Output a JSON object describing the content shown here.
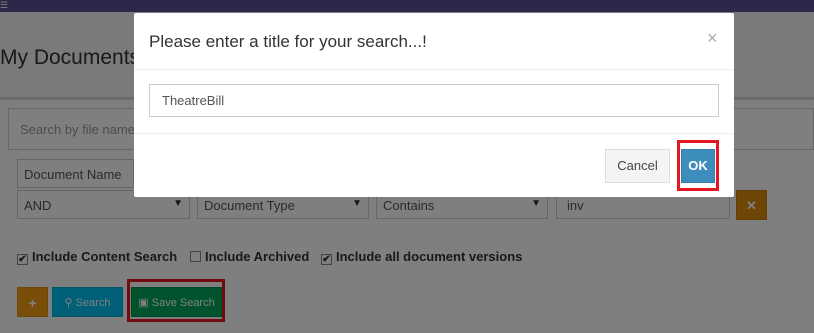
{
  "header": {
    "menu_icon": "hamburger-icon"
  },
  "page": {
    "title": "My Documents"
  },
  "search": {
    "placeholder": "Search by file name"
  },
  "filters": {
    "row1_field": "Document Name",
    "row2_logic": "AND",
    "row2_field": "Document Type",
    "row2_operator": "Contains",
    "row2_value": "inv",
    "remove_icon": "times-icon"
  },
  "options": [
    {
      "label": "Include Content Search",
      "checked": true
    },
    {
      "label": "Include Archived",
      "checked": false
    },
    {
      "label": "Include all document versions",
      "checked": true
    }
  ],
  "actions": {
    "add_label": "+",
    "search_label": "Search",
    "save_search_label": "Save Search"
  },
  "modal": {
    "title": "Please enter a title for your search...!",
    "close_label": "×",
    "input_value": "TheatreBill",
    "cancel_label": "Cancel",
    "ok_label": "OK"
  },
  "colors": {
    "topbar": "#5b4f93",
    "highlight": "#e3171f",
    "ok_button": "#3c8dbc",
    "save_button": "#00a65a",
    "search_button": "#00c0ef",
    "add_button": "#f39c12"
  }
}
